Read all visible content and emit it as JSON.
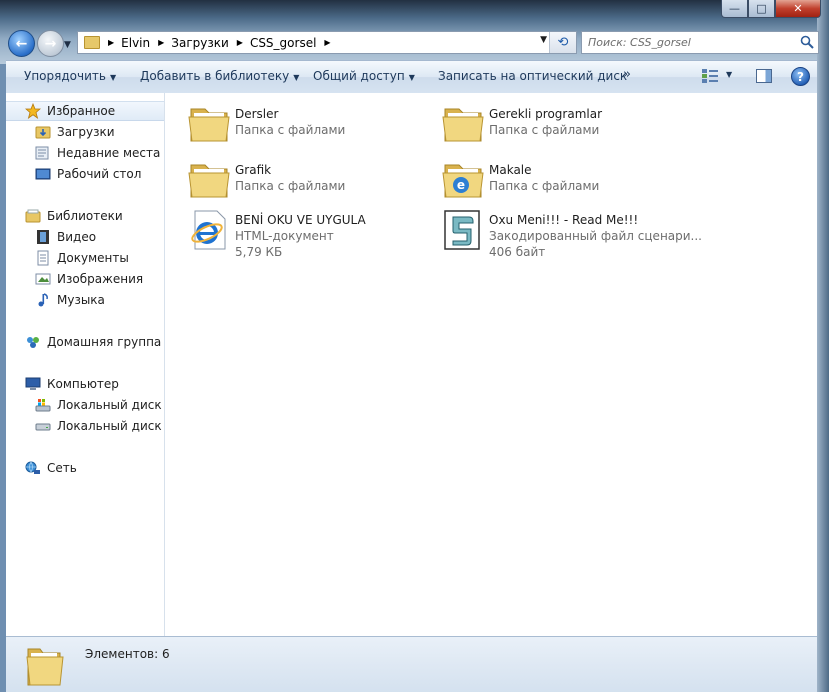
{
  "window": {
    "minimize_glyph": "—",
    "maximize_glyph": "□",
    "close_glyph": "✕"
  },
  "navigation": {
    "back_glyph": "←",
    "forward_glyph": "→",
    "breadcrumbs": [
      "Elvin",
      "Загрузки",
      "CSS_gorsel"
    ],
    "search_placeholder": "Поиск: CSS_gorsel"
  },
  "toolbar": {
    "organize": "Упорядочить",
    "add_to_library": "Добавить в библиотеку",
    "share": "Общий доступ",
    "burn": "Записать на оптический диск",
    "more": "»",
    "help": "?"
  },
  "sidebar": {
    "favorites": {
      "label": "Избранное",
      "items": [
        "Загрузки",
        "Недавние места",
        "Рабочий стол"
      ]
    },
    "libraries": {
      "label": "Библиотеки",
      "items": [
        "Видео",
        "Документы",
        "Изображения",
        "Музыка"
      ]
    },
    "homegroup": {
      "label": "Домашняя группа"
    },
    "computer": {
      "label": "Компьютер",
      "items": [
        "Локальный диск (C:)",
        "Локальный диск (D:)"
      ]
    },
    "network": {
      "label": "Сеть"
    }
  },
  "files": [
    {
      "name": "Dersler",
      "type": "Папка с файлами",
      "size": "",
      "icon": "folder-icon"
    },
    {
      "name": "Gerekli programlar",
      "type": "Папка с файлами",
      "size": "",
      "icon": "folder-icon"
    },
    {
      "name": "Grafik",
      "type": "Папка с файлами",
      "size": "",
      "icon": "folder-icon"
    },
    {
      "name": "Makale",
      "type": "Папка с файлами",
      "size": "",
      "icon": "folder-ie-icon"
    },
    {
      "name": "BENİ OKU VE UYGULA",
      "type": "HTML-документ",
      "size": "5,79 КБ",
      "icon": "html-document-icon"
    },
    {
      "name": "Oxu Meni!!! - Read Me!!!",
      "type": "Закодированный файл сценари...",
      "size": "406 байт",
      "icon": "script-file-icon"
    }
  ],
  "status": {
    "item_count": "Элементов: 6"
  }
}
